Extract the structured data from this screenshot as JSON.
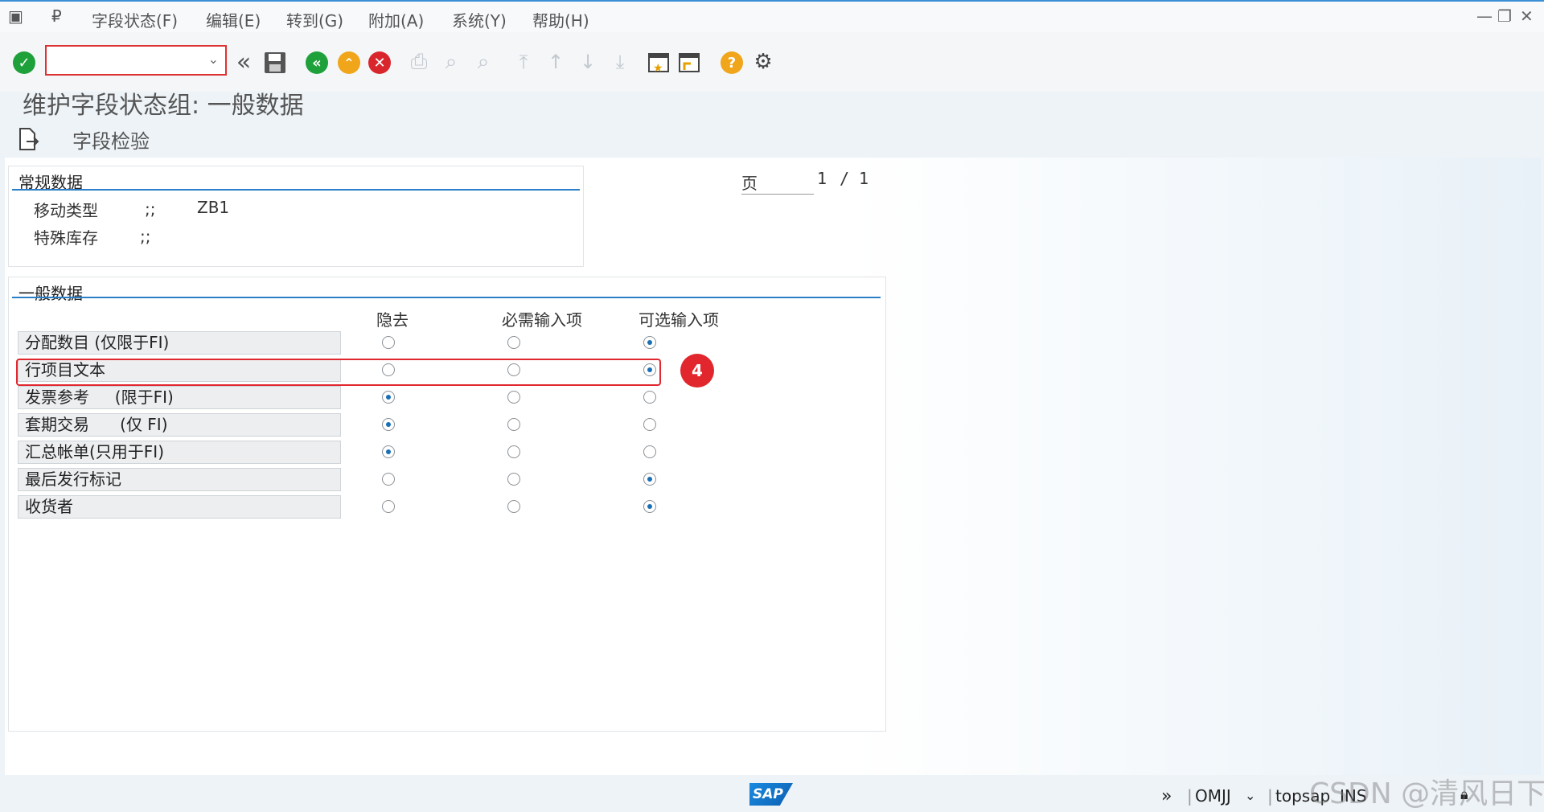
{
  "menubar": {
    "items": [
      "字段状态(F)",
      "编辑(E)",
      "转到(G)",
      "附加(A)",
      "系统(Y)",
      "帮助(H)"
    ],
    "window_controls": [
      "—",
      "❐",
      "✕"
    ]
  },
  "toolbar": {
    "command_field_value": "",
    "icons": [
      "enter-icon",
      "back-double-icon",
      "save-icon",
      "back-icon",
      "exit-icon",
      "cancel-icon",
      "print-icon",
      "find-icon",
      "find-next-icon",
      "first-page-icon",
      "prev-page-icon",
      "next-page-icon",
      "last-page-icon",
      "create-session-icon",
      "shortcut-icon",
      "help-icon",
      "settings-icon"
    ]
  },
  "screen_title": "维护字段状态组: 一般数据",
  "app_toolbar": {
    "field_check_label": "字段检验"
  },
  "general_group": {
    "title": "常规数据",
    "rows": [
      {
        "label": "移动类型",
        "sep": ";;",
        "value": "ZB1"
      },
      {
        "label": "特殊库存",
        "sep": ";;",
        "value": ""
      }
    ]
  },
  "page": {
    "label": "页",
    "current": "1",
    "sep": "/",
    "total": "1"
  },
  "general_data": {
    "title": "一般数据",
    "columns": [
      "隐去",
      "必需输入项",
      "可选输入项"
    ],
    "rows": [
      {
        "label": "分配数目 (仅限于FI)",
        "selected": 2
      },
      {
        "label": "行项目文本",
        "selected": 2
      },
      {
        "label": "发票参考     (限于FI)",
        "selected": 0
      },
      {
        "label": "套期交易      (仅 FI)",
        "selected": 0
      },
      {
        "label": "汇总帐单(只用于FI)",
        "selected": 0
      },
      {
        "label": "最后发行标记",
        "selected": 2
      },
      {
        "label": "收货者",
        "selected": 2
      }
    ]
  },
  "annotation": {
    "badge": "4"
  },
  "status_bar": {
    "logo": "SAP",
    "transaction": "OMJJ",
    "server": "topsap",
    "mode": "INS"
  },
  "watermark": "CSDN @清风日下"
}
